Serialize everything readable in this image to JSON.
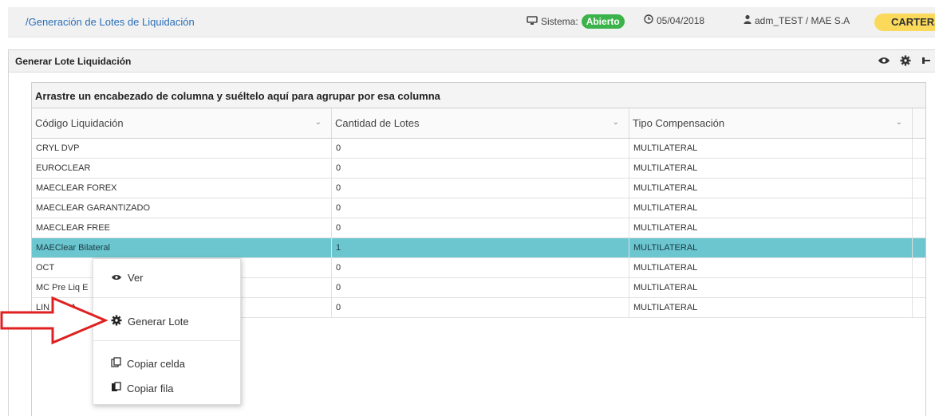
{
  "topbar": {
    "breadcrumb": "/Generación de Lotes de Liquidación",
    "sistema_label": "Sistema:",
    "sistema_status": "Abierto",
    "date": "05/04/2018",
    "user": "adm_TEST / MAE S.A",
    "cartera": "CARTERA",
    "status_color": "#3cb34a",
    "cartera_color": "#fbd95b"
  },
  "panel": {
    "title": "Generar Lote Liquidación",
    "tools": [
      "eye-icon",
      "gear-icon",
      "pin-icon"
    ]
  },
  "grid": {
    "group_hint": "Arrastre un encabezado de columna y suéltelo aquí para agrupar por esa columna",
    "columns": [
      "Código Liquidación",
      "Cantidad de Lotes",
      "Tipo Compensación"
    ],
    "rows": [
      [
        "CRYL DVP",
        "0",
        "MULTILATERAL"
      ],
      [
        "EUROCLEAR",
        "0",
        "MULTILATERAL"
      ],
      [
        "MAECLEAR FOREX",
        "0",
        "MULTILATERAL"
      ],
      [
        "MAECLEAR GARANTIZADO",
        "0",
        "MULTILATERAL"
      ],
      [
        "MAECLEAR FREE",
        "0",
        "MULTILATERAL"
      ],
      [
        "MAEClear Bilateral",
        "1",
        "MULTILATERAL"
      ],
      [
        "OCT",
        "0",
        "MULTILATERAL"
      ],
      [
        "MC Pre Liq E",
        "0",
        "MULTILATERAL"
      ],
      [
        "LIN BCRA",
        "0",
        "MULTILATERAL"
      ]
    ],
    "selected_index": 5,
    "selected_color": "#6cc6cf"
  },
  "context_menu": {
    "ver": "Ver",
    "generar": "Generar Lote",
    "copiar_celda": "Copiar celda",
    "copiar_fila": "Copiar fila"
  },
  "arrow_color": "#e02020"
}
